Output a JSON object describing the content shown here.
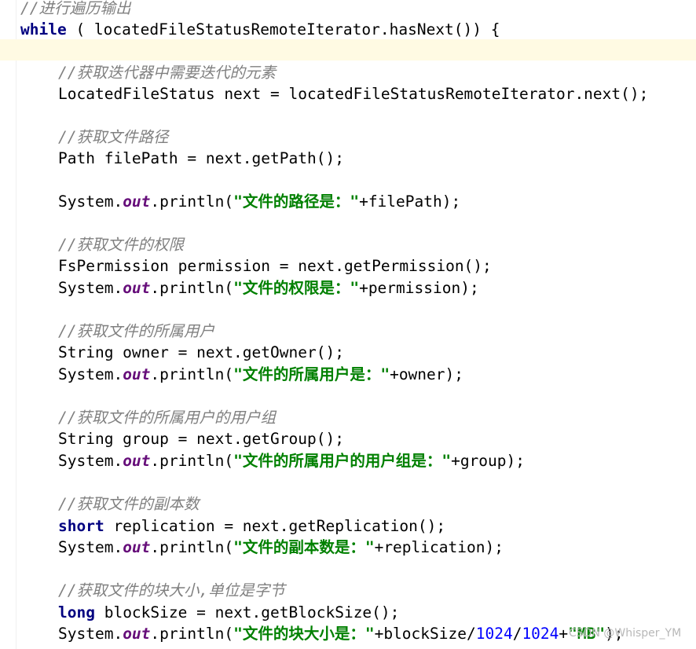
{
  "editor": {
    "lines": {
      "l1": {
        "comment": "//进行遍历输出"
      },
      "l2": {
        "kw": "while",
        "text": " ( locatedFileStatusRemoteIterator.hasNext()) {"
      },
      "l3": {
        "comment": "//获取迭代器中需要迭代的元素"
      },
      "l4": {
        "text": "LocatedFileStatus next = locatedFileStatusRemoteIterator.next();"
      },
      "l5": {
        "comment": "//获取文件路径"
      },
      "l6": {
        "text": "Path filePath = next.getPath();"
      },
      "l7": {
        "pre": "System.",
        "field": "out",
        "mid": ".println(",
        "str": "\"文件的路径是：\"",
        "post": "+filePath);"
      },
      "l8": {
        "comment": "//获取文件的权限"
      },
      "l9": {
        "text": "FsPermission permission = next.getPermission();"
      },
      "l10": {
        "pre": "System.",
        "field": "out",
        "mid": ".println(",
        "str": "\"文件的权限是：\"",
        "post": "+permission);"
      },
      "l11": {
        "comment": "//获取文件的所属用户"
      },
      "l12": {
        "text": "String owner = next.getOwner();"
      },
      "l13": {
        "pre": "System.",
        "field": "out",
        "mid": ".println(",
        "str": "\"文件的所属用户是：\"",
        "post": "+owner);"
      },
      "l14": {
        "comment": "//获取文件的所属用户的用户组"
      },
      "l15": {
        "text": "String group = next.getGroup();"
      },
      "l16": {
        "pre": "System.",
        "field": "out",
        "mid": ".println(",
        "str": "\"文件的所属用户的用户组是：\"",
        "post": "+group);"
      },
      "l17": {
        "comment": "//获取文件的副本数"
      },
      "l18": {
        "kw": "short",
        "text": " replication = next.getReplication();"
      },
      "l19": {
        "pre": "System.",
        "field": "out",
        "mid": ".println(",
        "str": "\"文件的副本数是：\"",
        "post": "+replication);"
      },
      "l20": {
        "comment": "//获取文件的块大小,单位是字节"
      },
      "l21": {
        "kw": "long",
        "text": " blockSize = next.getBlockSize();"
      },
      "l22": {
        "pre": "System.",
        "field": "out",
        "mid": ".println(",
        "str": "\"文件的块大小是：\"",
        "mid2": "+blockSize/",
        "num1": "1024",
        "slash": "/",
        "num2": "1024",
        "plus": "+",
        "str2": "\"MB\"",
        "post": ");"
      }
    }
  },
  "watermark": "CSDN @Whisper_YM",
  "colors": {
    "keyword": "#000080",
    "comment": "#808080",
    "string": "#008000",
    "field": "#660e7a",
    "number": "#0000ff",
    "caret_line": "#fffae3"
  }
}
